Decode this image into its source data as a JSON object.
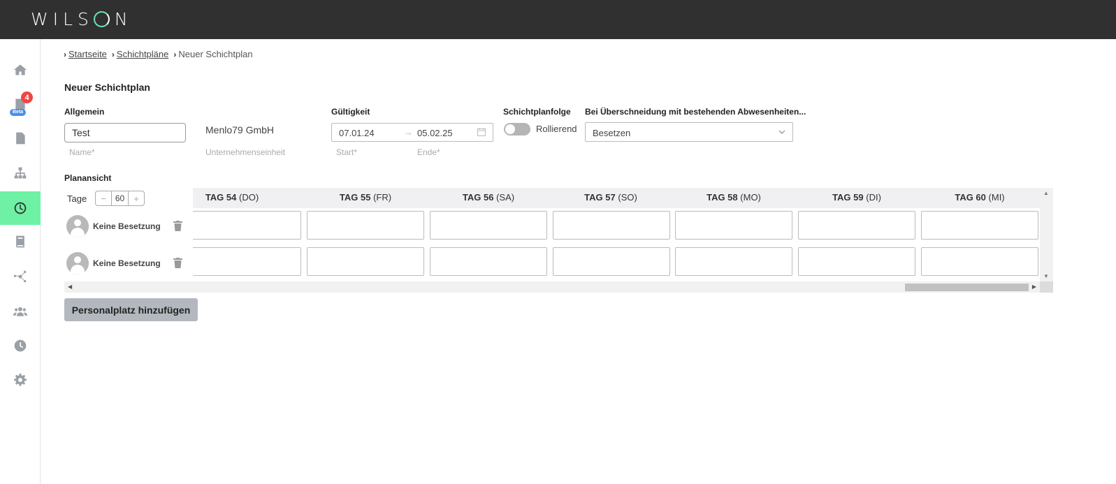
{
  "app": {
    "logo_prefix": "WILS",
    "logo_suffix": "N"
  },
  "sidebar": {
    "items": [
      {
        "name": "home",
        "icon": "home-icon"
      },
      {
        "name": "documents",
        "icon": "document-icon",
        "badge": "4",
        "tag": "Beta"
      },
      {
        "name": "report",
        "icon": "alert-file-icon"
      },
      {
        "name": "organization",
        "icon": "network-icon"
      },
      {
        "name": "shifts",
        "icon": "clock-icon",
        "active": true
      },
      {
        "name": "book",
        "icon": "book-icon"
      },
      {
        "name": "connections",
        "icon": "nodes-icon"
      },
      {
        "name": "users",
        "icon": "users-icon"
      },
      {
        "name": "time",
        "icon": "clock-solid-icon"
      },
      {
        "name": "settings",
        "icon": "gear-icon"
      }
    ]
  },
  "breadcrumb": {
    "home": "Startseite",
    "list": "Schichtpläne",
    "current": "Neuer Schichtplan"
  },
  "page_title": "Neuer Schichtplan",
  "general": {
    "label": "Allgemein",
    "name_value": "Test",
    "name_hint": "Name*",
    "company": "Menlo79 GmbH",
    "company_hint": "Unternehmenseinheit"
  },
  "validity": {
    "label": "Gültigkeit",
    "start": "07.01.24",
    "arrow": "→",
    "end": "05.02.25",
    "start_hint": "Start*",
    "end_hint": "Ende*"
  },
  "sequence": {
    "label": "Schichtplanfolge",
    "toggle_label": "Rollierend",
    "enabled": false
  },
  "overlap": {
    "label": "Bei Überschneidung mit bestehenden Abwesenheiten...",
    "value": "Besetzen"
  },
  "plan": {
    "label": "Planansicht",
    "days_label": "Tage",
    "days_value": "60",
    "minus": "−",
    "plus": "+",
    "columns": [
      {
        "day": "TAG 54",
        "weekday": "(DO)"
      },
      {
        "day": "TAG 55",
        "weekday": "(FR)"
      },
      {
        "day": "TAG 56",
        "weekday": "(SA)"
      },
      {
        "day": "TAG 57",
        "weekday": "(SO)"
      },
      {
        "day": "TAG 58",
        "weekday": "(MO)"
      },
      {
        "day": "TAG 59",
        "weekday": "(DI)"
      },
      {
        "day": "TAG 60",
        "weekday": "(MI)"
      }
    ],
    "rows": [
      {
        "person": "Keine Besetzung"
      },
      {
        "person": "Keine Besetzung"
      }
    ]
  },
  "add_button": "Personalplatz hinzufügen",
  "colors": {
    "topbar": "#303030",
    "accent": "#6ef1a5",
    "badge": "#f04545",
    "beta": "#4a8fe8"
  }
}
